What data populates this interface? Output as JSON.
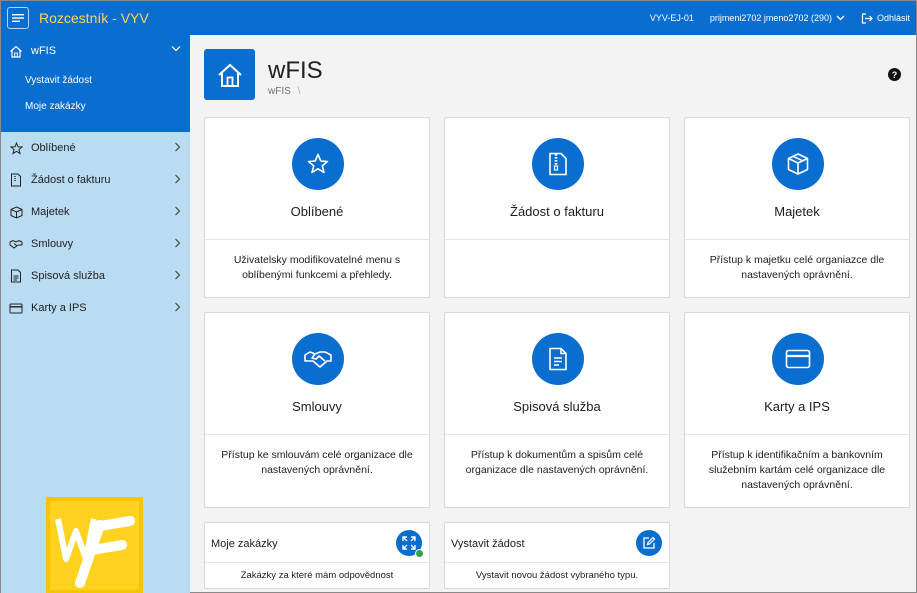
{
  "topbar": {
    "title": "Rozcestník - VYV",
    "environment": "VYV-EJ-01",
    "user": "prijmeni2702 jmeno2702 (290)",
    "logout": "Odhlásit"
  },
  "sidebar": {
    "active": {
      "label": "wFIS",
      "subitems": [
        "Vystavit žádost",
        "Moje zakázky"
      ]
    },
    "items": [
      {
        "label": "Oblíbené",
        "icon": "star-icon"
      },
      {
        "label": "Žádost o fakturu",
        "icon": "document-icon"
      },
      {
        "label": "Majetek",
        "icon": "box-icon"
      },
      {
        "label": "Smlouvy",
        "icon": "handshake-icon"
      },
      {
        "label": "Spisová služba",
        "icon": "file-icon"
      },
      {
        "label": "Karty a IPS",
        "icon": "card-icon"
      }
    ]
  },
  "header": {
    "title": "wFIS",
    "breadcrumb": "wFIS",
    "breadcrumb_separator": "\\",
    "help": "?"
  },
  "cards": [
    {
      "title": "Oblíbené",
      "description": "Uživatelsky modifikovatelné menu s oblíbenými funkcemi a přehledy.",
      "icon": "star-icon"
    },
    {
      "title": "Žádost o fakturu",
      "description": "",
      "icon": "zip-document-icon"
    },
    {
      "title": "Majetek",
      "description": "Přístup k majetku celé organiazce dle nastavených oprávnění.",
      "icon": "box-icon"
    },
    {
      "title": "Smlouvy",
      "description": "Přístup ke smlouvám celé organizace dle nastavených oprávnění.",
      "icon": "handshake-icon"
    },
    {
      "title": "Spisová služba",
      "description": "Přístup k dokumentům a spisům celé organizace dle nastavených oprávnění.",
      "icon": "file-lines-icon"
    },
    {
      "title": "Karty a IPS",
      "description": "Přístup k identifikačním a bankovním služebním kartám celé organizace dle nastavených oprávnění.",
      "icon": "card-icon"
    }
  ],
  "mini_cards": [
    {
      "title": "Moje zakázky",
      "description": "Zakázky za které mám odpovědnost",
      "icon": "expand-icon"
    },
    {
      "title": "Vystavit žádost",
      "description": "Vystavit novou žádost vybraného typu.",
      "icon": "edit-icon"
    }
  ],
  "colors": {
    "primary": "#0a6ed1",
    "sidebar": "#b9dcf3",
    "title_accent": "#ffd44d",
    "logo": "#ffd21f"
  }
}
